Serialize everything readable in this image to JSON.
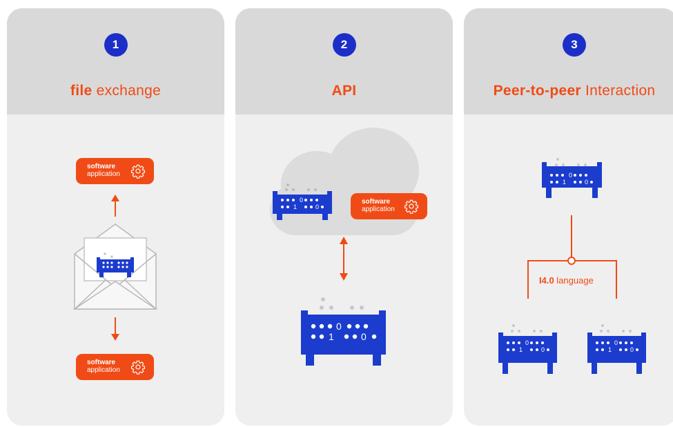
{
  "colors": {
    "accent": "#f04b16",
    "device": "#1b3ccd",
    "panel": "#efefef",
    "panel_head": "#d9d9d9"
  },
  "panels": [
    {
      "number": "1",
      "title_bold": "file",
      "title_rest": " exchange"
    },
    {
      "number": "2",
      "title_bold": "API",
      "title_rest": ""
    },
    {
      "number": "3",
      "title_bold": "Peer-to-peer",
      "title_rest": " Interaction"
    }
  ],
  "software": {
    "line1": "software",
    "line2": "application",
    "icon": "gear-icon"
  },
  "device_digits": {
    "row1": "0",
    "row2": "1 0"
  },
  "language": {
    "bold": "I4.0",
    "rest": " language"
  }
}
